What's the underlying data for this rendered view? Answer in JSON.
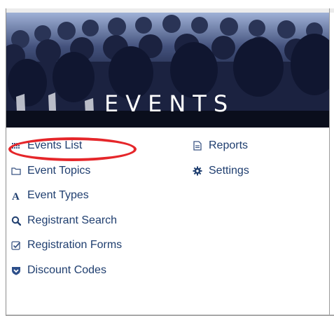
{
  "hero": {
    "title": "EVENTS"
  },
  "menu": {
    "col1": [
      {
        "label": "Events List",
        "icon": "calendar-grid-icon"
      },
      {
        "label": "Event Topics",
        "icon": "folder-icon"
      },
      {
        "label": "Event Types",
        "icon": "letter-a-icon"
      },
      {
        "label": "Registrant Search",
        "icon": "search-icon"
      },
      {
        "label": "Registration Forms",
        "icon": "check-square-icon"
      },
      {
        "label": "Discount Codes",
        "icon": "shield-tag-icon"
      }
    ],
    "col2": [
      {
        "label": "Reports",
        "icon": "document-icon"
      },
      {
        "label": "Settings",
        "icon": "gear-icon"
      }
    ]
  },
  "colors": {
    "link": "#1f3e6f",
    "highlight": "#e5262a"
  }
}
